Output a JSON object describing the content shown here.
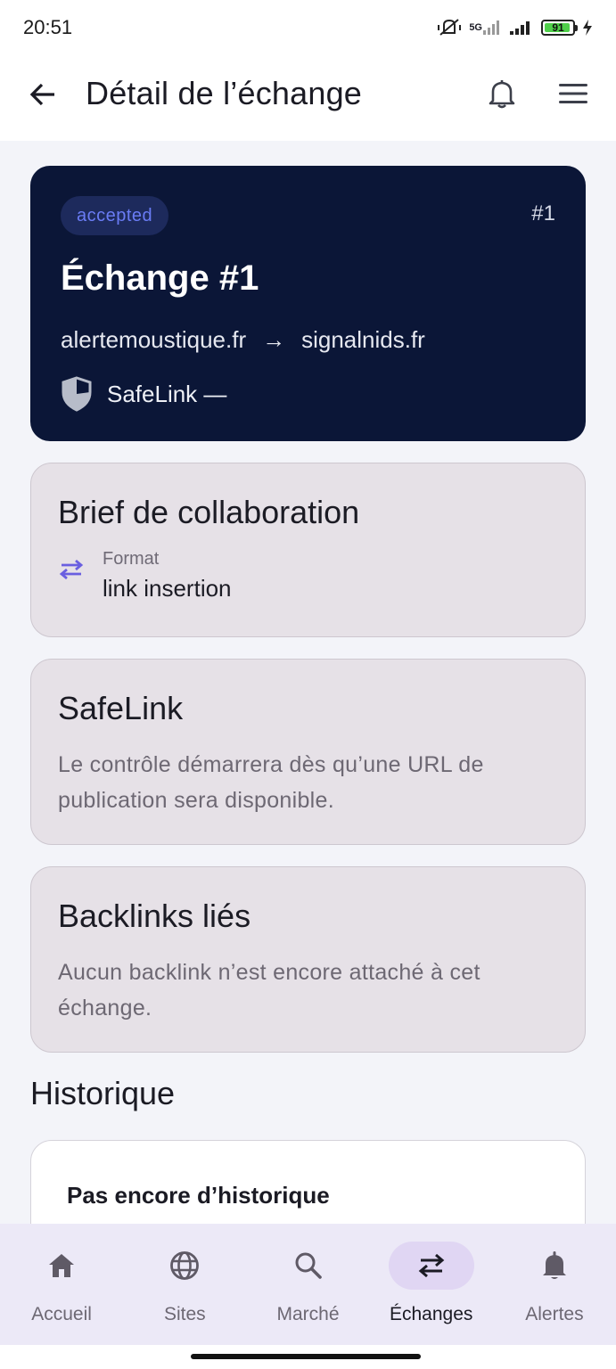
{
  "status_bar": {
    "time": "20:51",
    "network": "5G",
    "battery": "91"
  },
  "app_bar": {
    "title": "Détail de l’échange",
    "icons": [
      "arrow-left-icon",
      "bell-icon",
      "hamburger-menu-icon"
    ]
  },
  "hero": {
    "status": "accepted",
    "number": "#1",
    "title": "Échange #1",
    "from_site": "alertemoustique.fr",
    "arrow": "→",
    "to_site": "signalnids.fr",
    "safelink_label": "SafeLink —"
  },
  "brief": {
    "title": "Brief de collaboration",
    "format_label": "Format",
    "format_value": "link insertion"
  },
  "safelink_card": {
    "title": "SafeLink",
    "text": "Le contrôle démarrera dès qu’une URL de publication sera disponible."
  },
  "backlinks_card": {
    "title": "Backlinks liés",
    "text": "Aucun backlink n’est encore attaché à cet échange."
  },
  "history": {
    "title": "Historique",
    "empty_text": "Pas encore d’historique"
  },
  "bottom_nav": {
    "items": [
      {
        "label": "Accueil",
        "icon": "home-icon"
      },
      {
        "label": "Sites",
        "icon": "globe-icon"
      },
      {
        "label": "Marché",
        "icon": "search-icon"
      },
      {
        "label": "Échanges",
        "icon": "swap-icon",
        "active": true
      },
      {
        "label": "Alertes",
        "icon": "bell-icon"
      }
    ]
  },
  "colors": {
    "hero_bg": "#0b1637",
    "accent": "#6a5fe0",
    "card_bg": "#e6e1e7",
    "nav_active_pill": "#e0d6f3"
  }
}
